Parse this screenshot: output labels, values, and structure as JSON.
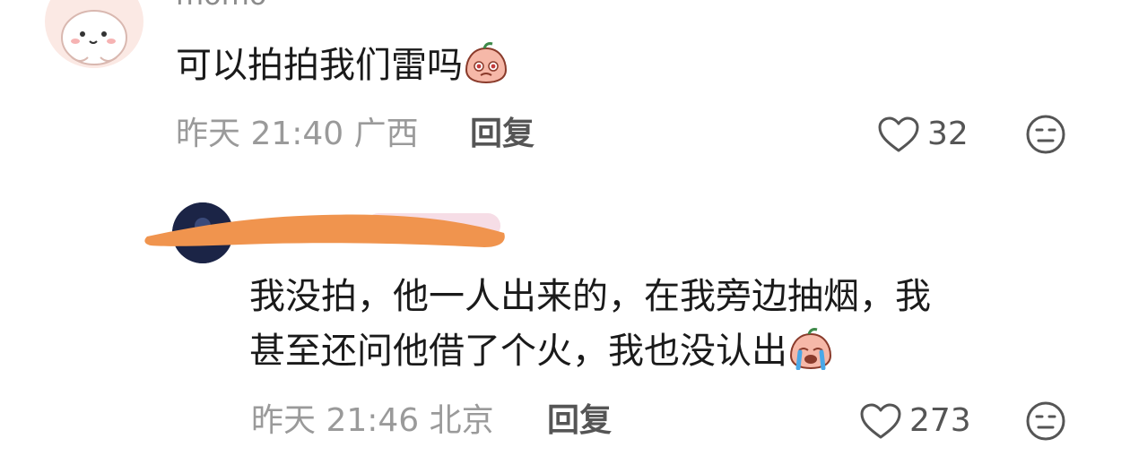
{
  "comments": [
    {
      "username": "momo",
      "avatar": "cute-bun-avatar",
      "text": "可以拍拍我们雷吗",
      "emoji": "teary-peach-emoji",
      "time": "昨天 21:40",
      "location": "广西",
      "reply_label": "回复",
      "likes": "32"
    },
    {
      "username": "",
      "avatar": "dark-avatar",
      "text_line1": "我没拍，他一人出来的，在我旁边抽烟，我",
      "text_line2": "甚至还问他借了个火，我也没认出",
      "emoji": "crying-peach-emoji",
      "time": "昨天 21:46",
      "location": "北京",
      "reply_label": "回复",
      "likes": "273"
    }
  ],
  "colors": {
    "text": "#1a1a1a",
    "meta": "#9a9a9a",
    "redaction": "#f0944e",
    "avatar_bg": "#fbe9e4"
  },
  "icons": [
    "heart-outline-icon",
    "meh-face-icon"
  ]
}
